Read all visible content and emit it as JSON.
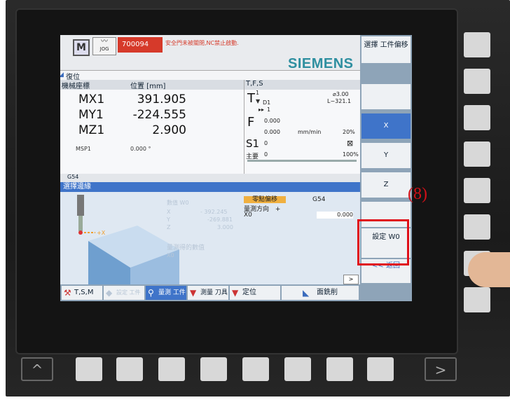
{
  "header": {
    "mode_icon": "M",
    "jog_label": "JOG",
    "alarm_number": "700094",
    "alarm_text": "安全門未被關閉,NC禁止啟動.",
    "brand": "SIEMENS",
    "reset_label": "復位"
  },
  "position": {
    "col_machine": "機械座標",
    "col_position": "位置 [mm]",
    "rows": [
      {
        "axis": "MX1",
        "value": "391.905"
      },
      {
        "axis": "MY1",
        "value": "-224.555"
      },
      {
        "axis": "MZ1",
        "value": "2.900"
      }
    ],
    "spindle_pos_axis": "MSP1",
    "spindle_pos_value": "0.000 °"
  },
  "tfs": {
    "header": "T,F,S",
    "t_label": "T",
    "t_num": "1",
    "d_label": "D1",
    "t_next": "1",
    "tool_dia": "⌀3.00",
    "tool_len": "L−321.1",
    "f_label": "F",
    "f_val1": "0.000",
    "f_val2": "0.000",
    "f_unit": "mm/min",
    "f_pct": "20%",
    "s_label": "S1",
    "s_val": "0",
    "main_label": "主要",
    "main_val": "0",
    "s_pct": "100%"
  },
  "g54_row": "G54",
  "work": {
    "title": "選擇邊緣",
    "ghost_head": "數值 W0",
    "ghost_rows": [
      {
        "a": "X",
        "v": "- 392.245"
      },
      {
        "a": "Y",
        "v": "-269.881"
      },
      {
        "a": "Z",
        "v": "3.000"
      }
    ],
    "ghost_measured": "量測得的數值",
    "ghost_x0": "X0",
    "zero_offset": "零點偏移",
    "zero_value": "G54",
    "measure_dir": "量測方向",
    "measure_dir_sign": "+",
    "x0_label": "X0",
    "x0_value": "0.000",
    "plus_x": "+X"
  },
  "hsoftkeys": [
    {
      "label": "T,S,M"
    },
    {
      "label": "設定 工件"
    },
    {
      "label": "量測 工件"
    },
    {
      "label": "測量 刀具"
    },
    {
      "label": "定位"
    },
    {
      "label": "面銑削"
    }
  ],
  "vsoftkeys": [
    {
      "label": "選擇 工件偏移"
    },
    {
      "label": ""
    },
    {
      "label": "X"
    },
    {
      "label": "Y"
    },
    {
      "label": "Z"
    },
    {
      "label": ""
    },
    {
      "label": "設定 W0"
    },
    {
      "label": "<< 返回"
    }
  ],
  "annotation": "(8)",
  "nav": {
    "left": "^",
    "right": ">"
  }
}
